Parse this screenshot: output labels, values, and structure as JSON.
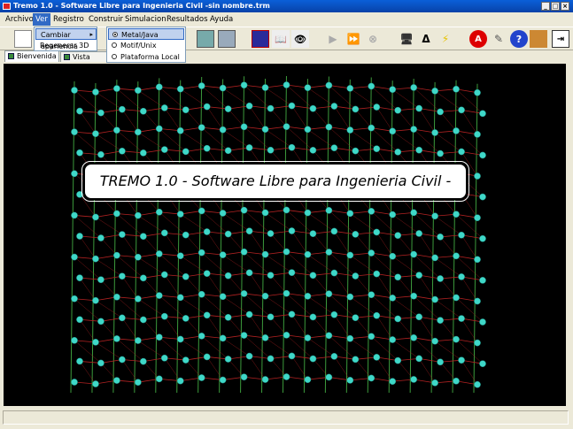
{
  "window": {
    "title": "Tremo 1.0 - Software Libre para Ingenieria Civil -sin nombre.trm",
    "minimize_label": "_",
    "maximize_label": "□",
    "close_label": "×"
  },
  "menubar": {
    "items": [
      "Archivo",
      "Ver",
      "Registro",
      "Construir",
      "Simulacion",
      "Resultados",
      "Ayuda"
    ],
    "active": "Ver"
  },
  "ver_menu": {
    "items": [
      "Cambiar apariencia",
      "Regenerar 3D"
    ],
    "submenu_arrow": "▸"
  },
  "apariencia_submenu": {
    "options": [
      "Metal/Java",
      "Motif/Unix",
      "Plataforma Local"
    ],
    "selected": "Metal/Java"
  },
  "toolbar": {
    "icons": [
      "new-document-icon",
      "image-icon",
      "texture-icon",
      "grid-icon",
      "book-icon",
      "eye-icon",
      "play-icon",
      "forward-icon",
      "stop-icon",
      "computer-icon",
      "delta-icon",
      "lightning-icon",
      "stop-sign-icon",
      "pencil-icon",
      "help-icon",
      "emblem-icon",
      "exit-icon"
    ],
    "delta_label": "Δ",
    "help_label": "?",
    "stop_label": "A"
  },
  "tabs": {
    "items": [
      "Bienvenida",
      "Vista Uno"
    ],
    "selected": "Bienvenida"
  },
  "viewport": {
    "banner": "TREMO 1.0 - Software Libre para Ingenieria Civil -",
    "background": "#000000",
    "node_color": "#3fd8c8",
    "column_color": "#3c9a3c",
    "beam_color": "#b22222"
  },
  "statusbar": {
    "text": ""
  },
  "colors": {
    "titlebar": "#0a5fd8",
    "menu_highlight": "#316ac5",
    "chrome": "#ece9d8"
  }
}
